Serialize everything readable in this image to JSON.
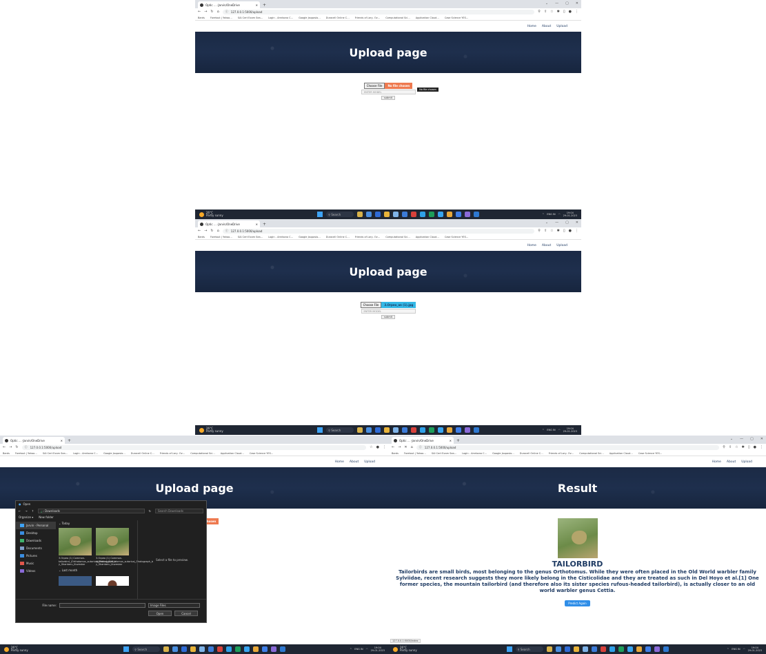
{
  "browser": {
    "tab_title": "Optic … ·Jarvin/OneDrive",
    "new_tab": "+",
    "win_controls": [
      "⌄",
      "—",
      "▢",
      "✕"
    ],
    "address": "127.0.0.1:5000/upload",
    "bookmarks": [
      "Bards",
      "Foretout | Yahoo…",
      "SAI Cert Exam Sea…",
      "Login - Amrbono C…",
      "Google Jaupaslo…",
      "Duracell Online C…",
      "Friends of Lary- Ov…",
      "Computational Sci…",
      "Application Cloud…",
      "Case Science YES…"
    ]
  },
  "nav": {
    "home": "Home",
    "about": "About",
    "upload": "Upload"
  },
  "upload_page": {
    "title": "Upload page",
    "choose_file": "Choose File",
    "no_file": "No file chosen",
    "tooltip": "No file chosen",
    "selected_file": "3.Orpeo_an (1).jpg",
    "model_placeholder": "ENTER MODEL",
    "submit": "submit"
  },
  "dialog": {
    "title": "Open",
    "path": "Downloads",
    "search_placeholder": "Search Downloads",
    "organize": "Organize ▾",
    "new_folder": "New folder",
    "group_today": "Today",
    "group_last_month": "Last month",
    "sidebar": [
      "Jarvin - Personal",
      "Desktop",
      "Downloads",
      "Documents",
      "Pictures",
      "Music",
      "Videos"
    ],
    "files": [
      {
        "caption": "3.Orpeo (1) Common-tailorbird_(Orthotomus_sutorius)_Photograph_b y_Shantanu_Kuveskar"
      },
      {
        "caption": "3.Orpeo (1) Common-tailorbird_(Orthotomus_sutorius)_Photograph_b y_Shantanu_Kuveskar"
      }
    ],
    "preview_text": "Select a file to preview.",
    "file_name_label": "File name:",
    "file_type": "Image Files",
    "open": "Open",
    "cancel": "Cancel"
  },
  "result_page": {
    "title": "Result",
    "label": "TAILORBIRD",
    "description": "Tailorbirds are small birds, most belonging to the genus Orthotomus. While they were often placed in the Old World warbler family Sylviidae, recent research suggests they more likely belong in the Cisticolidae and they are treated as such in Del Hoyo et al.[1] One former species, the mountain tailorbird (and therefore also its sister species rufous-headed tailorbird), is actually closer to an old world warbler genus Cettia.",
    "predict_again": "Predict Again",
    "status_url": "127.0.0.1:5000/index"
  },
  "taskbar": {
    "weather_temp": "26°C",
    "weather_text": "Partly sunny",
    "search": "Search",
    "lang": "ENG IN",
    "time": "19:04",
    "date": "29-01-2023"
  },
  "colors": {
    "banner": "#1e2f4d",
    "accent_orange": "#ee7a50",
    "accent_blue": "#34b8e6",
    "predict_button": "#2f8ee8",
    "text_navy": "#1f3b63"
  }
}
